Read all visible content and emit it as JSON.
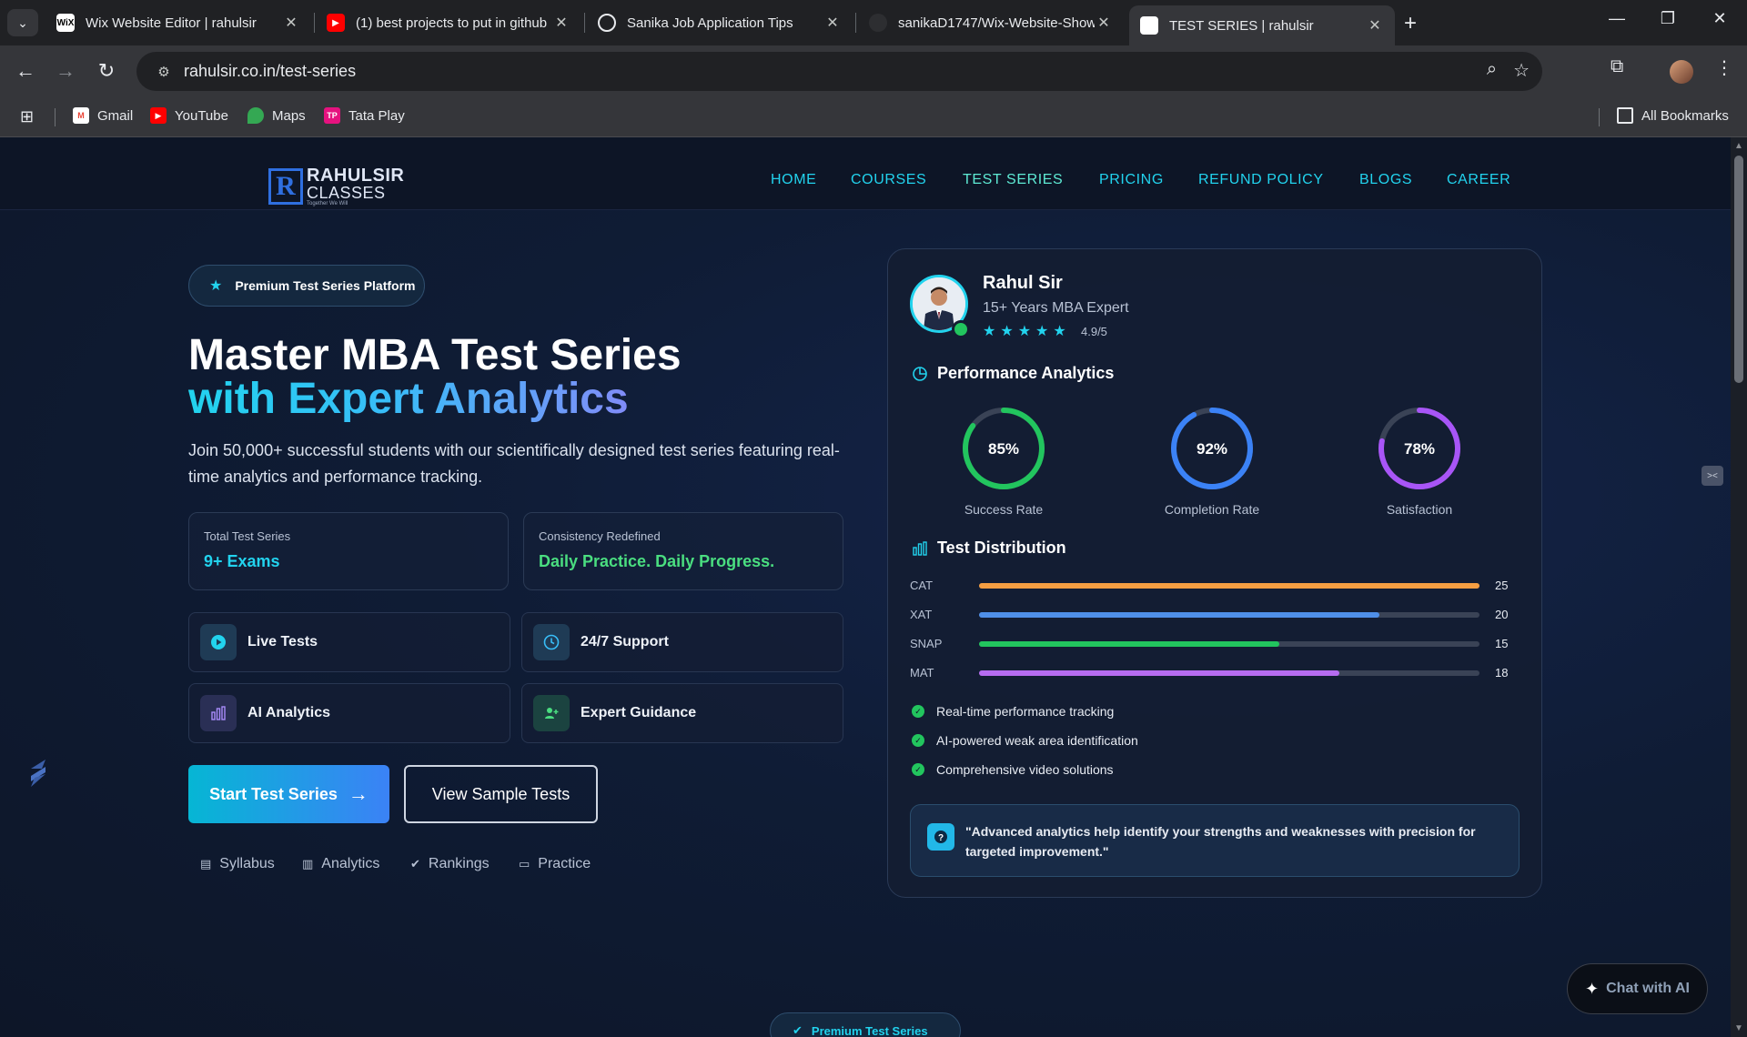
{
  "browser": {
    "tabs": [
      {
        "title": "Wix Website Editor | rahulsir",
        "favicon": "WiX",
        "favicon_color": "#ffffff"
      },
      {
        "title": "(1) best projects to put in github",
        "favicon": "youtube-icon",
        "favicon_color": "#ff0000"
      },
      {
        "title": "Sanika Job Application Tips",
        "favicon": "chatgpt-icon",
        "favicon_color": "#e8eaed"
      },
      {
        "title": "sanikaD1747/Wix-Website-Show",
        "favicon": "github-icon",
        "favicon_color": "#e8eaed"
      },
      {
        "title": "TEST SERIES | rahulsir",
        "favicon": "page-icon",
        "favicon_color": "#ffffff",
        "active": true
      }
    ],
    "url": "rahulsir.co.in/test-series",
    "bookmarks": [
      {
        "label": "Gmail",
        "icon": "gmail-icon",
        "color": "#ea4335"
      },
      {
        "label": "YouTube",
        "icon": "youtube-icon",
        "color": "#ff0000"
      },
      {
        "label": "Maps",
        "icon": "maps-icon",
        "color": "#34a853"
      },
      {
        "label": "Tata Play",
        "icon": "tataplay-icon",
        "color": "#e6127f"
      }
    ],
    "all_bookmarks": "All Bookmarks"
  },
  "site": {
    "logo": {
      "letter": "R",
      "line1": "RAHULSIR",
      "line2": "CLASSES",
      "tagline": "Together We Will"
    },
    "nav": [
      "HOME",
      "COURSES",
      "TEST SERIES",
      "PRICING",
      "REFUND POLICY",
      "BLOGS",
      "CAREER"
    ],
    "nav_active": "TEST SERIES"
  },
  "hero": {
    "badge": "Premium Test Series Platform",
    "title_line1": "Master MBA Test Series",
    "title_line2": "with Expert Analytics",
    "lead": "Join 50,000+ successful students with our scientifically designed test series featuring real-time analytics and performance tracking.",
    "stats": [
      {
        "label": "Total Test Series",
        "value": "9+ Exams",
        "color": "#22d3ee"
      },
      {
        "label": "Consistency Redefined",
        "value": "Daily Practice. Daily Progress.",
        "color": "#4ade80"
      }
    ],
    "features": [
      {
        "label": "Live Tests",
        "icon": "play-icon"
      },
      {
        "label": "24/7 Support",
        "icon": "clock-icon"
      },
      {
        "label": "AI Analytics",
        "icon": "bar-chart-icon"
      },
      {
        "label": "Expert Guidance",
        "icon": "user-plus-icon"
      }
    ],
    "primary_cta": "Start Test Series",
    "secondary_cta": "View Sample Tests",
    "mini_links": [
      {
        "label": "Syllabus",
        "icon": "file-icon"
      },
      {
        "label": "Analytics",
        "icon": "bar-chart-icon"
      },
      {
        "label": "Rankings",
        "icon": "badge-check-icon"
      },
      {
        "label": "Practice",
        "icon": "presentation-icon"
      }
    ]
  },
  "card": {
    "name": "Rahul Sir",
    "subtitle": "15+ Years MBA Expert",
    "stars": "★★★★★",
    "rating": "4.9/5",
    "performance_title": "Performance Analytics",
    "rings": [
      {
        "value": 85,
        "text": "85%",
        "label": "Success Rate",
        "color": "#22c55e"
      },
      {
        "value": 92,
        "text": "92%",
        "label": "Completion Rate",
        "color": "#3b82f6"
      },
      {
        "value": 78,
        "text": "78%",
        "label": "Satisfaction",
        "color": "#a855f7"
      }
    ],
    "distribution_title": "Test Distribution",
    "distribution_max": 25,
    "distribution": [
      {
        "name": "CAT",
        "value": 25,
        "color": "#f59e42"
      },
      {
        "name": "XAT",
        "value": 20,
        "color": "#4f8fe8"
      },
      {
        "name": "SNAP",
        "value": 15,
        "color": "#22c55e"
      },
      {
        "name": "MAT",
        "value": 18,
        "color": "#b66cf0"
      }
    ],
    "checks": [
      "Real-time performance tracking",
      "AI-powered weak area identification",
      "Comprehensive video solutions"
    ],
    "quote": "\"Advanced analytics help identify your strengths and weaknesses with precision for targeted improvement.\""
  },
  "chat_button": "Chat with AI",
  "bottom_badge": "Premium Test Series"
}
